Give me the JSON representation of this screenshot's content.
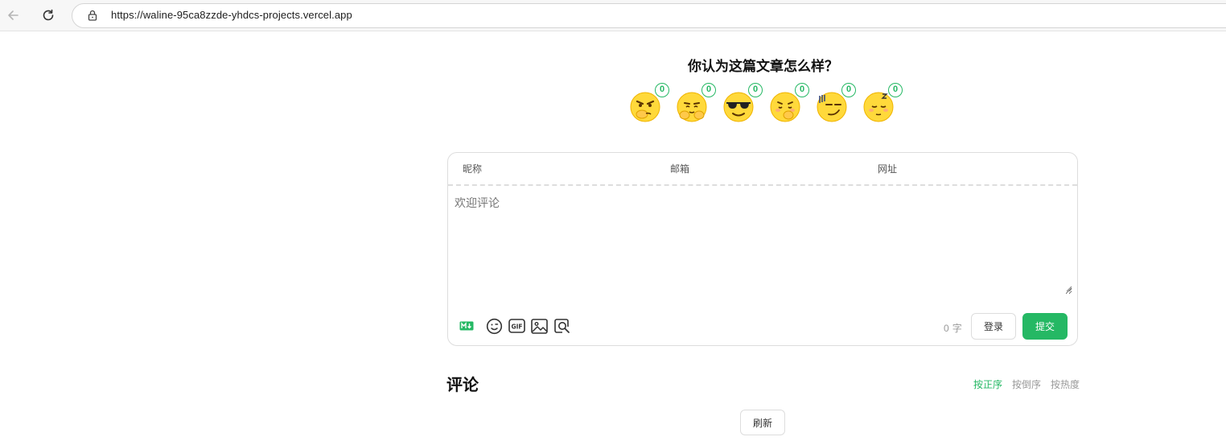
{
  "browser": {
    "url": "https://waline-95ca8zzde-yhdcs-projects.vercel.app"
  },
  "reaction": {
    "title": "你认为这篇文章怎么样？",
    "items": [
      {
        "icon": "angry-face-icon",
        "count": "0"
      },
      {
        "icon": "hugging-face-icon",
        "count": "0"
      },
      {
        "icon": "cool-sunglasses-face-icon",
        "count": "0"
      },
      {
        "icon": "shushing-face-icon",
        "count": "0"
      },
      {
        "icon": "sweating-face-icon",
        "count": "0"
      },
      {
        "icon": "sleeping-face-icon",
        "count": "0"
      }
    ]
  },
  "editor": {
    "nick_placeholder": "昵称",
    "mail_placeholder": "邮箱",
    "link_placeholder": "网址",
    "content_placeholder": "欢迎评论",
    "word_count": "0",
    "word_unit": "字",
    "login_label": "登录",
    "submit_label": "提交",
    "tools": [
      "markdown-icon",
      "emoji-icon",
      "gif-icon",
      "image-icon",
      "preview-icon"
    ]
  },
  "comments": {
    "title": "评论",
    "sort_options": [
      "按正序",
      "按倒序",
      "按热度"
    ],
    "active_sort": "按正序",
    "refresh_label": "刷新"
  },
  "colors": {
    "accent": "#25b864",
    "border": "#dddddd",
    "muted": "#999999"
  }
}
